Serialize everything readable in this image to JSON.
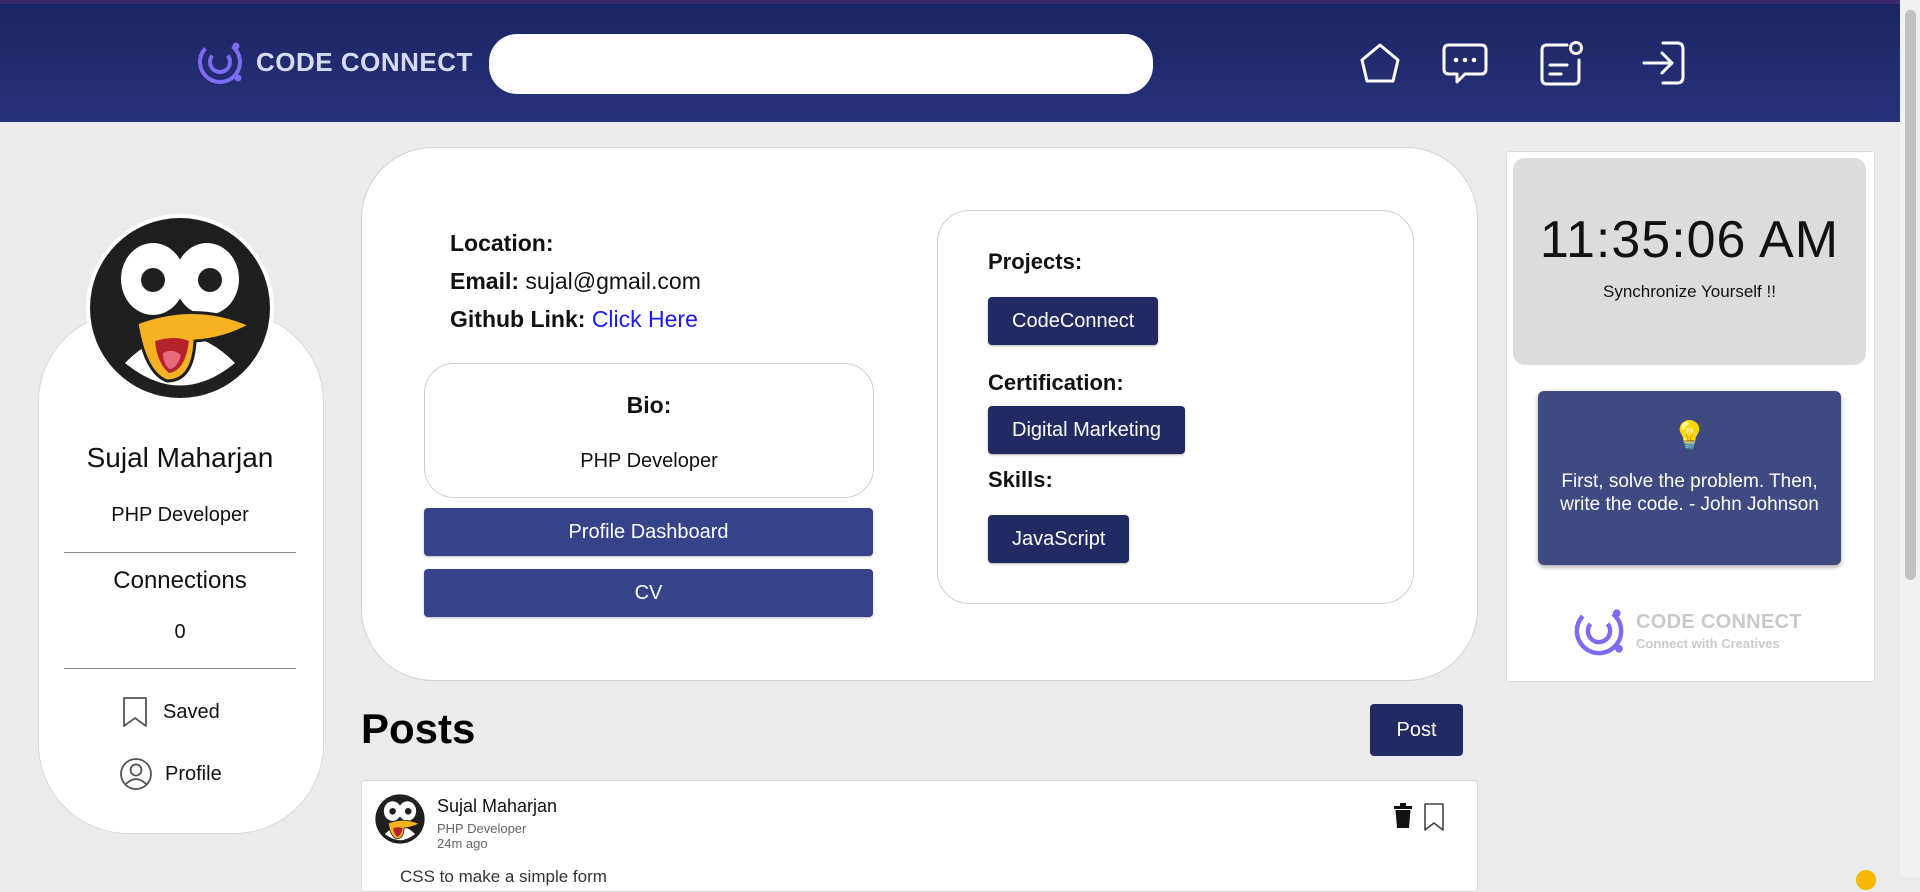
{
  "header": {
    "brand": "CODE CONNECT",
    "search_placeholder": "",
    "nav_icons": [
      "home-icon",
      "messages-icon",
      "notifications-icon",
      "logout-icon"
    ]
  },
  "profile": {
    "name": "Sujal Maharjan",
    "role": "PHP Developer",
    "connections_label": "Connections",
    "connections_count": "0",
    "saved_label": "Saved",
    "profile_label": "Profile"
  },
  "info": {
    "location_label": "Location:",
    "location_value": "",
    "email_label": "Email:",
    "email_value": "sujal@gmail.com",
    "github_label": "Github Link:",
    "github_link_text": "Click Here",
    "bio_title": "Bio:",
    "bio_text": "PHP Developer",
    "dashboard_button": "Profile Dashboard",
    "cv_button": "CV",
    "projects_label": "Projects:",
    "projects": [
      "CodeConnect"
    ],
    "certification_label": "Certification:",
    "certifications": [
      "Digital Marketing"
    ],
    "skills_label": "Skills:",
    "skills": [
      "JavaScript"
    ]
  },
  "posts": {
    "title": "Posts",
    "post_button": "Post",
    "items": [
      {
        "author": "Sujal Maharjan",
        "role": "PHP Developer",
        "time": "24m ago",
        "body": "CSS to make a simple form"
      }
    ]
  },
  "widget": {
    "clock": "11:35:06 AM",
    "clock_caption": "Synchronize Yourself !!",
    "quote_icon": "💡",
    "quote": "First, solve the problem. Then, write the code. - John Johnson",
    "logo_title": "CODE CONNECT",
    "logo_subtitle": "Connect with Creatives"
  },
  "colors": {
    "header": "#1b2462",
    "accent": "#212a63",
    "button": "#36428a",
    "link": "#1a1aff",
    "quote_bg": "#3f4a82"
  }
}
